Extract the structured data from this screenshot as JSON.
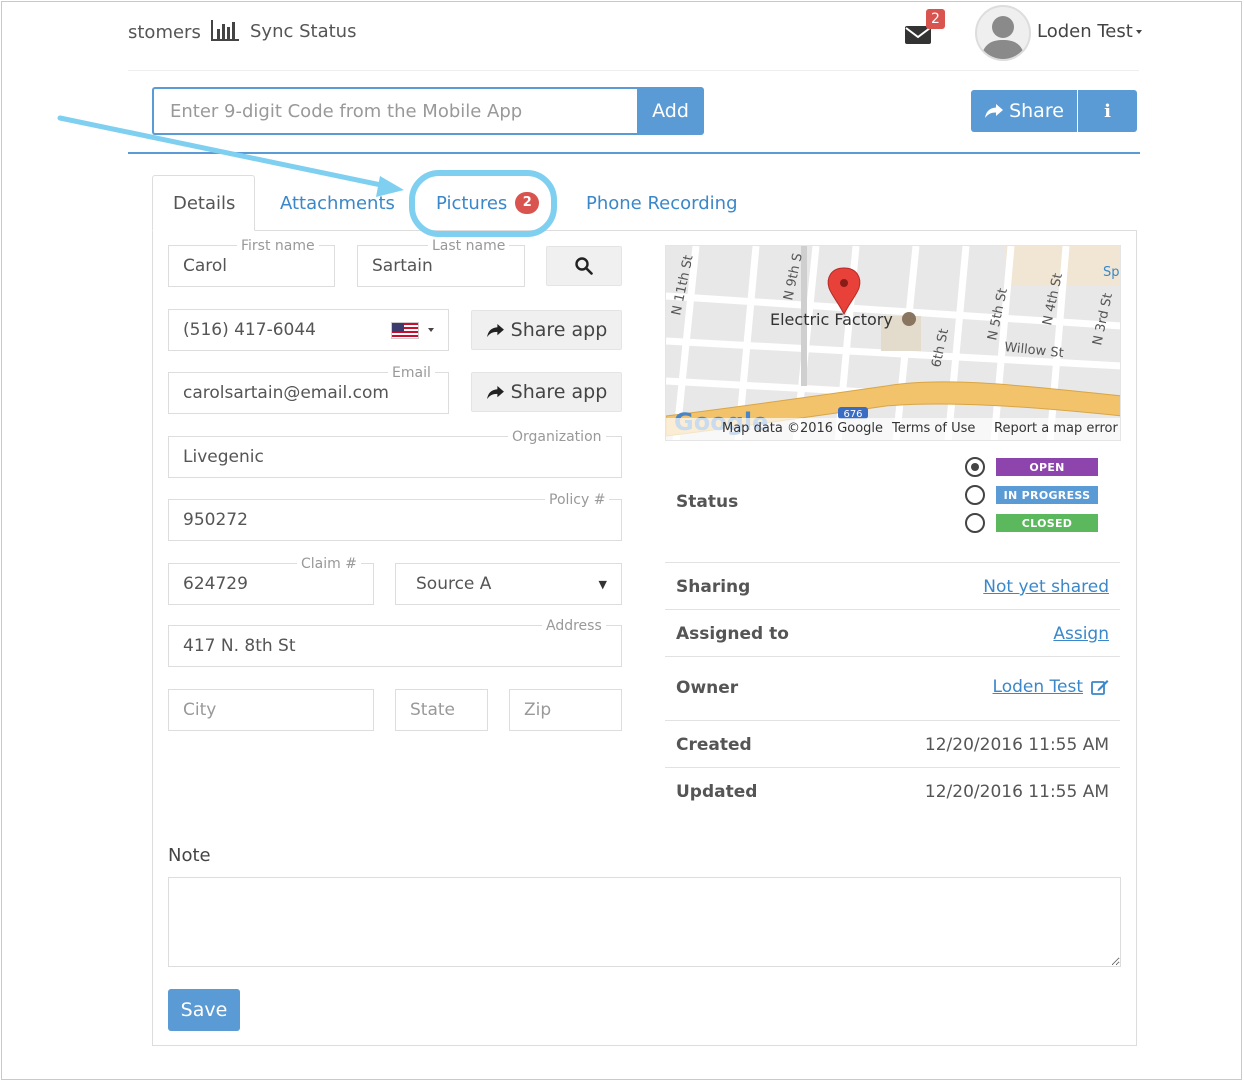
{
  "nav": {
    "customers_partial": "stomers",
    "sync_status": "Sync Status",
    "mail_badge": "2",
    "user_name": "Loden Test"
  },
  "code_entry": {
    "placeholder": "Enter 9-digit Code from the Mobile App",
    "add_label": "Add"
  },
  "header_actions": {
    "share_label": "Share",
    "info_label": "i"
  },
  "tabs": [
    {
      "label": "Details",
      "active": true
    },
    {
      "label": "Attachments"
    },
    {
      "label": "Pictures",
      "badge": "2"
    },
    {
      "label": "Phone Recording"
    }
  ],
  "form": {
    "first_name": {
      "label": "First name",
      "value": "Carol"
    },
    "last_name": {
      "label": "Last name",
      "value": "Sartain"
    },
    "phone": {
      "value": "(516) 417-6044"
    },
    "email": {
      "label": "Email",
      "value": "carolsartain@email.com"
    },
    "share_app_label": "Share app",
    "organization": {
      "label": "Organization",
      "value": "Livegenic"
    },
    "policy": {
      "label": "Policy #",
      "value": "950272"
    },
    "claim": {
      "label": "Claim #",
      "value": "624729"
    },
    "source": {
      "value": "Source A"
    },
    "address": {
      "label": "Address",
      "value": "417 N. 8th St"
    },
    "city": {
      "placeholder": "City"
    },
    "state": {
      "placeholder": "State"
    },
    "zip": {
      "placeholder": "Zip"
    }
  },
  "map": {
    "place": "Electric Factory",
    "streets": [
      "N 11th St",
      "N 9th S",
      "6th St",
      "N 5th St",
      "N 4th St",
      "N 3rd St",
      "Willow St",
      "Sp"
    ],
    "route_shield": "676",
    "google": "Google",
    "map_data": "Map data ©2016 Google",
    "terms": "Terms of Use",
    "report": "Report a map error"
  },
  "status": {
    "label": "Status",
    "options": [
      {
        "label": "OPEN",
        "color": "#8e44ad",
        "selected": true
      },
      {
        "label": "IN PROGRESS",
        "color": "#5b9bd5",
        "selected": false
      },
      {
        "label": "CLOSED",
        "color": "#5cb85c",
        "selected": false
      }
    ]
  },
  "info": {
    "sharing": {
      "label": "Sharing",
      "value": "Not yet shared"
    },
    "assigned": {
      "label": "Assigned to",
      "value": "Assign"
    },
    "owner": {
      "label": "Owner",
      "value": "Loden Test"
    },
    "created": {
      "label": "Created",
      "value": "12/20/2016 11:55 AM"
    },
    "updated": {
      "label": "Updated",
      "value": "12/20/2016 11:55 AM"
    }
  },
  "note": {
    "label": "Note"
  },
  "save_label": "Save",
  "colors": {
    "accent": "#5b9bd5",
    "badge": "#d9534f",
    "annotation": "#7ecff0"
  }
}
